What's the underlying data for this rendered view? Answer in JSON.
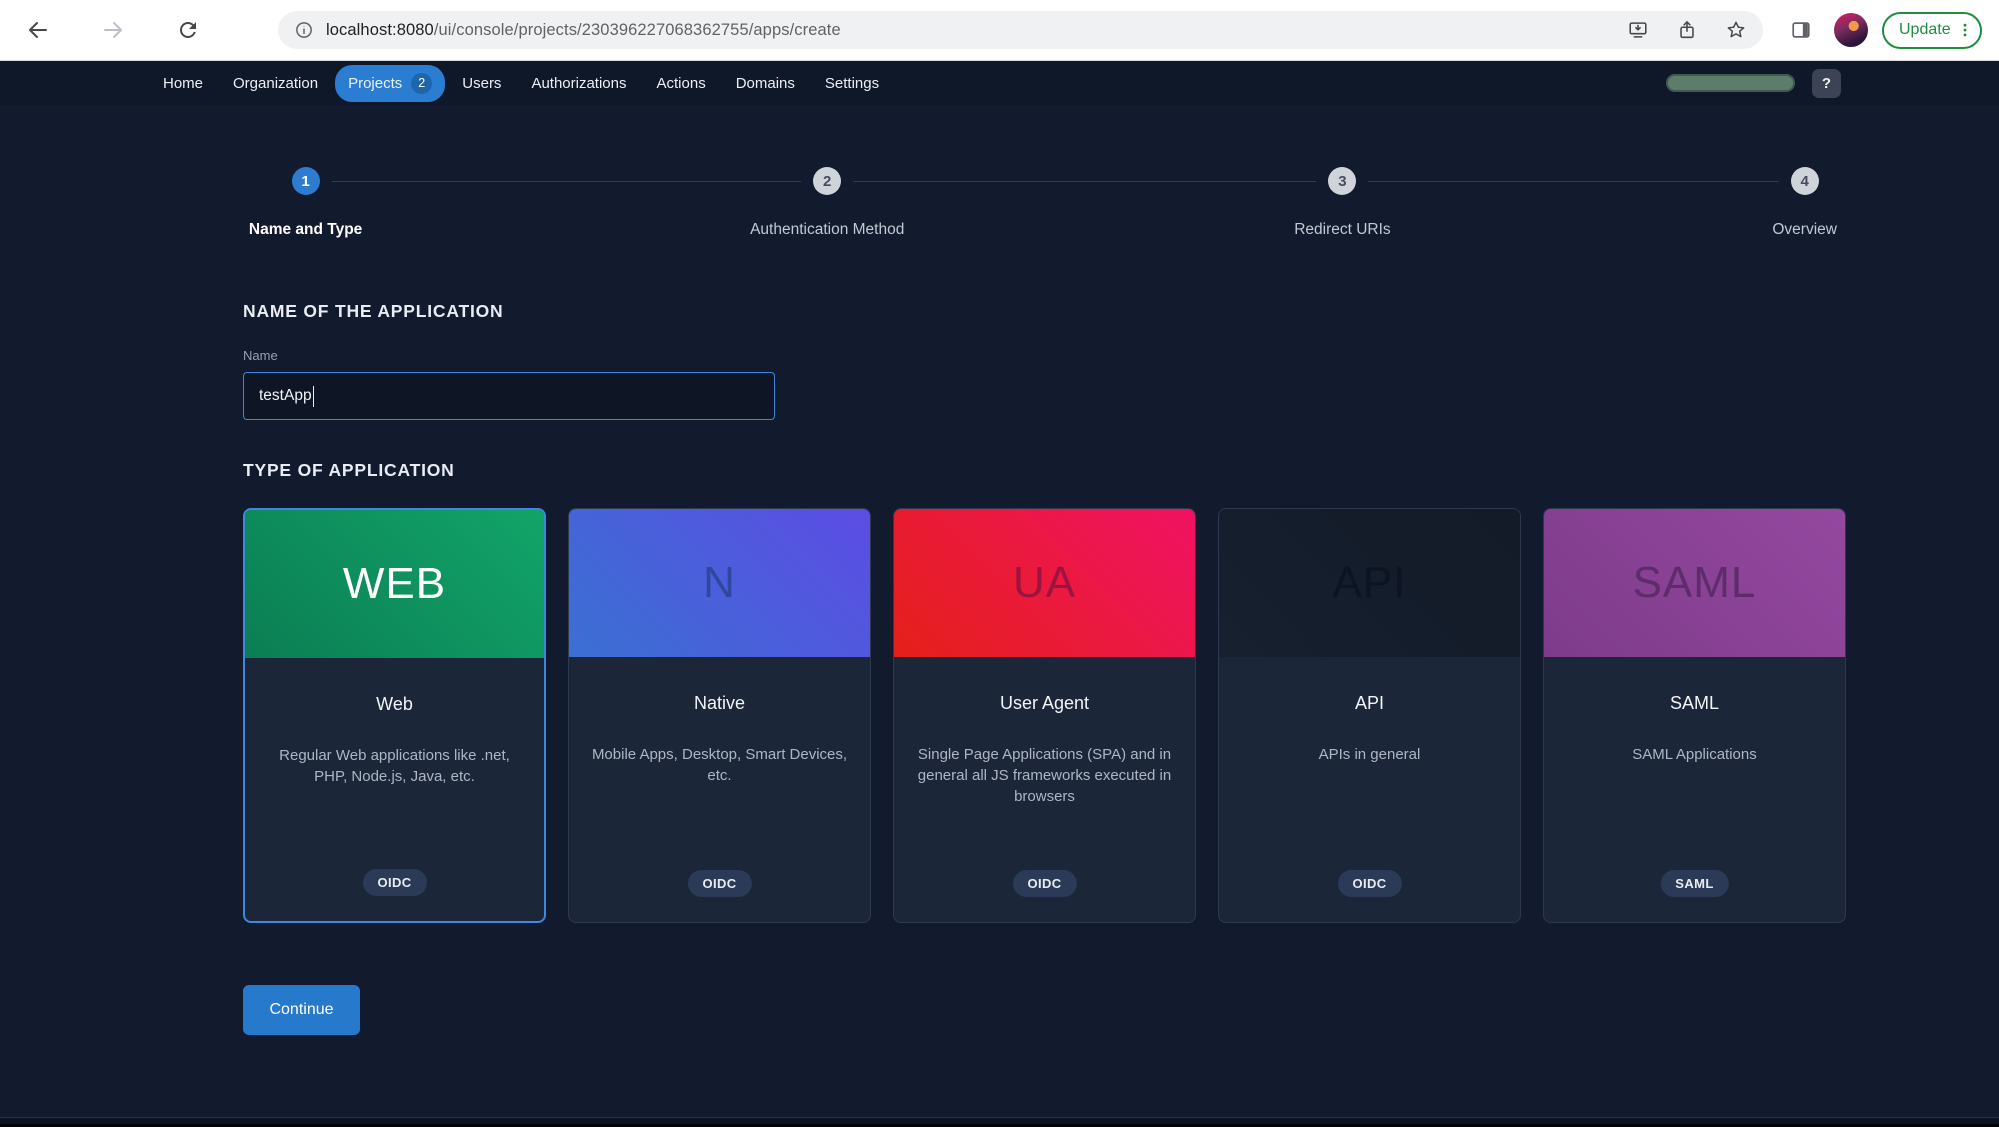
{
  "browser": {
    "url_domain": "localhost:8080",
    "url_path": "/ui/console/projects/230396227068362755/apps/create",
    "update_label": "Update"
  },
  "nav": {
    "items": [
      {
        "label": "Home",
        "active": false
      },
      {
        "label": "Organization",
        "active": false
      },
      {
        "label": "Projects",
        "badge": "2",
        "active": true
      },
      {
        "label": "Users",
        "active": false
      },
      {
        "label": "Authorizations",
        "active": false
      },
      {
        "label": "Actions",
        "active": false
      },
      {
        "label": "Domains",
        "active": false
      },
      {
        "label": "Settings",
        "active": false
      }
    ],
    "help_label": "?"
  },
  "stepper": {
    "steps": [
      {
        "number": "1",
        "label": "Name and Type",
        "state": "active"
      },
      {
        "number": "2",
        "label": "Authentication Method",
        "state": "upcoming"
      },
      {
        "number": "3",
        "label": "Redirect URIs",
        "state": "upcoming"
      },
      {
        "number": "4",
        "label": "Overview",
        "state": "upcoming"
      }
    ]
  },
  "form": {
    "name_section_title": "NAME OF THE APPLICATION",
    "name_label": "Name",
    "name_value": "testApp",
    "type_section_title": "TYPE OF APPLICATION",
    "continue_label": "Continue"
  },
  "cards": [
    {
      "id": "web",
      "abbr": "WEB",
      "abbr_color": "#ffffff",
      "gradient_from": "#0b7e53",
      "gradient_to": "#12a469",
      "title": "Web",
      "description": "Regular Web applications like .net, PHP, Node.js, Java, etc.",
      "protocol": "OIDC",
      "selected": true
    },
    {
      "id": "native",
      "abbr": "N",
      "abbr_color": "#31479e",
      "gradient_from": "#3a70d2",
      "gradient_to": "#5c4ce4",
      "title": "Native",
      "description": "Mobile Apps, Desktop, Smart Devices, etc.",
      "protocol": "OIDC",
      "selected": false
    },
    {
      "id": "user-agent",
      "abbr": "UA",
      "abbr_color": "#9c1340",
      "gradient_from": "#e52019",
      "gradient_to": "#f01263",
      "title": "User Agent",
      "description": "Single Page Applications (SPA) and in general all JS frameworks executed in browsers",
      "protocol": "OIDC",
      "selected": false
    },
    {
      "id": "api",
      "abbr": "API",
      "abbr_color": "#0c1423",
      "gradient_from": "#16202e",
      "gradient_to": "#131a28",
      "title": "API",
      "description": "APIs in general",
      "protocol": "OIDC",
      "selected": false
    },
    {
      "id": "saml",
      "abbr": "SAML",
      "abbr_color": "#5e2b6b",
      "gradient_from": "#7e3b8b",
      "gradient_to": "#94489f",
      "title": "SAML",
      "description": "SAML Applications",
      "protocol": "SAML",
      "selected": false
    }
  ],
  "colors": {
    "accent_blue": "#2b7dd2",
    "selected_border": "#3e87e2",
    "update_green": "#1e8e3e",
    "page_bg": "#121b2d",
    "card_bg": "#1c2639"
  }
}
